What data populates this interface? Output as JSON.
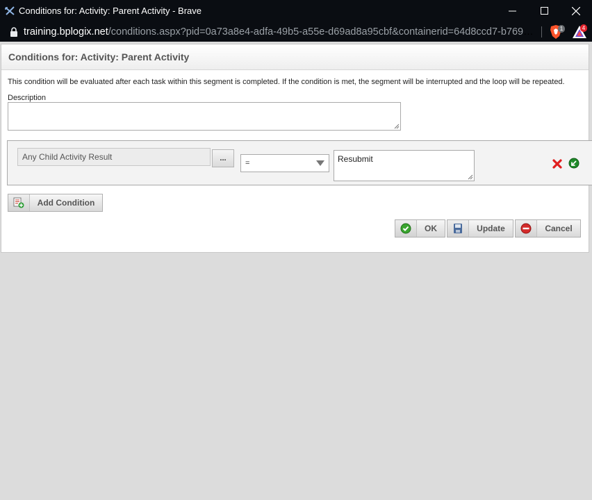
{
  "window": {
    "title": "Conditions for: Activity: Parent Activity - Brave",
    "minimize_icon": "minimize-icon",
    "maximize_icon": "maximize-icon",
    "close_icon": "close-icon"
  },
  "address_bar": {
    "host": "training.bplogix.net",
    "path": "/conditions.aspx?pid=0a73a8e4-adfa-49b5-a55e-d69ad8a95cbf&containerid=64d8ccd7-b769-46...",
    "shields_badge": "1",
    "rewards_badge": "4"
  },
  "dialog": {
    "title": "Conditions for: Activity: Parent Activity",
    "info_text": "This condition will be evaluated after each task within this segment is completed. If the condition is met, the segment will be interrupted and the loop will be repeated.",
    "description_label": "Description",
    "description_value": ""
  },
  "condition": {
    "field": "Any Child Activity Result",
    "picker_label": "...",
    "operator": "=",
    "value": "Resubmit"
  },
  "buttons": {
    "add_condition": "Add Condition",
    "ok": "OK",
    "update": "Update",
    "cancel": "Cancel"
  },
  "colors": {
    "titlebar": "#0a0d12",
    "ok_green": "#3aa52f",
    "cancel_red": "#d42b2b",
    "delete_red": "#e01e1e",
    "background": "#dcdcdc"
  }
}
